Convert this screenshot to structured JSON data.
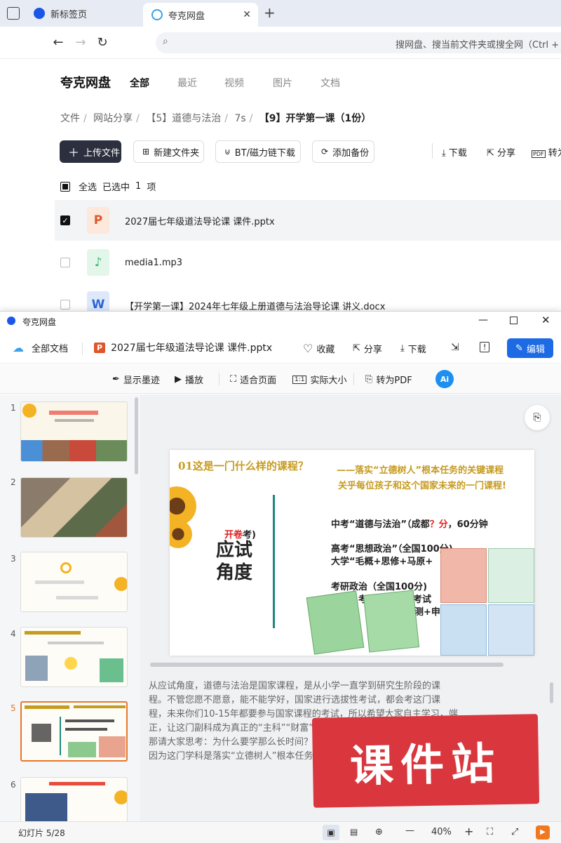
{
  "browser": {
    "tabs": [
      {
        "label": "新标签页",
        "active": false
      },
      {
        "label": "夸克网盘",
        "active": true
      }
    ],
    "new_tab": "+",
    "close": "✕",
    "address_placeholder": "搜网盘、搜当前文件夹或搜全网（Ctrl + F"
  },
  "drive": {
    "brand": "夸克网盘",
    "nav": [
      "全部",
      "最近",
      "视频",
      "图片",
      "文档"
    ],
    "breadcrumb": [
      "文件",
      "网站分享",
      "【5】道德与法治",
      "7s",
      "【9】开学第一课（1份）"
    ],
    "buttons": {
      "upload": "上传文件",
      "new_folder": "新建文件夹",
      "bt": "BT/磁力链下载",
      "backup": "添加备份",
      "download": "下载",
      "share": "分享",
      "convert": "转为"
    },
    "select_all": "全选",
    "selected_text": "已选中",
    "selected_count": "1",
    "selected_unit": "项",
    "files": [
      {
        "name": "2027届七年级道法导论课 课件.pptx",
        "type": "pptx",
        "checked": true
      },
      {
        "name": "media1.mp3",
        "type": "mp3",
        "checked": false
      },
      {
        "name": "【开学第一课】2024年七年级上册道德与法治导论课 讲义.docx",
        "type": "docx",
        "checked": false
      }
    ]
  },
  "viewer": {
    "window_title": "夸克网盘",
    "all_docs": "全部文档",
    "file_title": "2027届七年级道法导论课 课件.pptx",
    "actions": {
      "favorite": "收藏",
      "share": "分享",
      "download": "下载",
      "edit": "编辑"
    },
    "toolbar": {
      "ink": "显示墨迹",
      "play": "播放",
      "fit_page": "适合页面",
      "actual_size": "实际大小",
      "to_pdf": "转为PDF",
      "ai": "Ai"
    },
    "thumbnails": [
      "1",
      "2",
      "3",
      "4",
      "5",
      "6"
    ],
    "current_slide": 5,
    "slide": {
      "heading": "01这是一门什么样的课程？",
      "subhead_1": "——落实“立德树人”根本任务的关键课程",
      "subhead_2": "关乎每位孩子和这个国家未来的一门课程!",
      "left_small": "开卷",
      "left_small_2": "考)",
      "left_big_1": "应试",
      "left_big_2": "角度",
      "line_1a": "中考“道德与法治”（成都",
      "line_1b": "？分",
      "line_1c": "，60分钟",
      "line_2": "高考“思想政治”（全国100分)",
      "line_3": "大学“毛概+思修+马原+",
      "line_4": "考研政治（全国100分)",
      "line_5": "公务员考试、选调生考试",
      "line_6": "(行测+申"
    },
    "notes": [
      "从应试角度，道德与法治是国家课程，是从小学一直学到研究生阶段的课",
      "程。不管您愿不愿意，能不能学好，国家进行选拔性考试，都会考这门课",
      "程，未来你们10-15年都要参与国家课程的考试，所以希望大家自主学习，端",
      "正，让这门副科成为真正的“主科”“财富”的“富”",
      "那请大家思考：为什么要学那么长时间？",
      "因为这门学科是落实“立德树人”根本任务的关键课程，更是关乎每位孩子和这个国家未来"
    ],
    "status": {
      "slide_label": "幻灯片 5/28",
      "zoom": "40%",
      "minus": "—",
      "plus": "+"
    }
  },
  "watermark": "课件站",
  "colors": {
    "accent_blue": "#1d6ae5",
    "current_slide": "#e8782a",
    "watermark_red": "#d9363e",
    "upload_dark": "#2b2f3e"
  }
}
